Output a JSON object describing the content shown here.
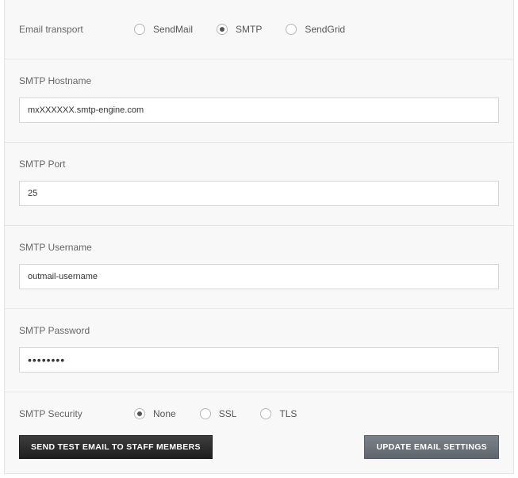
{
  "transport": {
    "label": "Email transport",
    "options": [
      {
        "label": "SendMail",
        "checked": false
      },
      {
        "label": "SMTP",
        "checked": true
      },
      {
        "label": "SendGrid",
        "checked": false
      }
    ]
  },
  "hostname": {
    "label": "SMTP Hostname",
    "value": "mxXXXXXX.smtp-engine.com"
  },
  "port": {
    "label": "SMTP Port",
    "value": "25"
  },
  "username": {
    "label": "SMTP Username",
    "value": "outmail-username"
  },
  "password": {
    "label": "SMTP Password",
    "masked": "••••••••"
  },
  "security": {
    "label": "SMTP Security",
    "options": [
      {
        "label": "None",
        "checked": true
      },
      {
        "label": "SSL",
        "checked": false
      },
      {
        "label": "TLS",
        "checked": false
      }
    ]
  },
  "buttons": {
    "send_test": "SEND TEST EMAIL TO STAFF MEMBERS",
    "update": "UPDATE EMAIL SETTINGS"
  }
}
